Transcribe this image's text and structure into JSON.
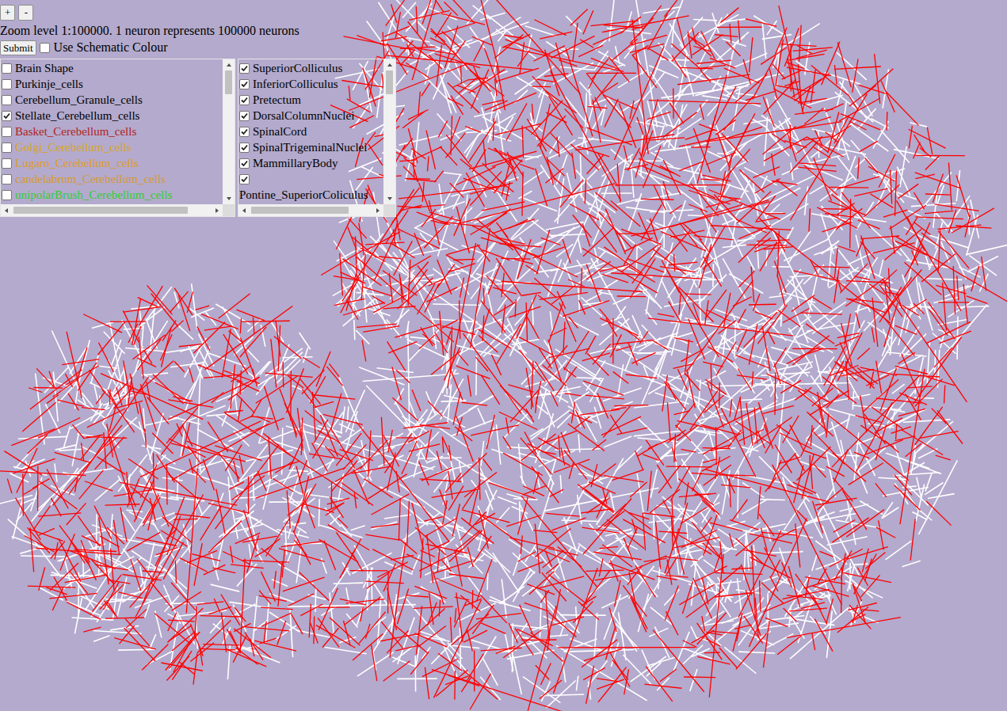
{
  "zoom": {
    "buttons": [
      "+",
      "-"
    ],
    "label": "Zoom level 1:100000. 1 neuron represents 100000 neurons"
  },
  "submit": {
    "label": "Submit"
  },
  "schematic": {
    "label": "Use Schematic Colour",
    "checked": false
  },
  "cell_list": [
    {
      "label": "Brain Shape",
      "checked": false,
      "color": "#000000"
    },
    {
      "label": "Purkinje_cells",
      "checked": false,
      "color": "#000000"
    },
    {
      "label": "Cerebellum_Granule_cells",
      "checked": false,
      "color": "#000000"
    },
    {
      "label": "Stellate_Cerebellum_cells",
      "checked": true,
      "color": "#000000"
    },
    {
      "label": "Basket_Cerebellum_cells",
      "checked": false,
      "color": "#b22222"
    },
    {
      "label": "Golgi_Cerebellum_cells",
      "checked": false,
      "color": "#daa520"
    },
    {
      "label": "Lugaro_Cerebellum_cells",
      "checked": false,
      "color": "#e09a2a"
    },
    {
      "label": "candelabrum_Cerebellum_cells",
      "checked": false,
      "color": "#d69a30"
    },
    {
      "label": "unipolarBrush_Cerebellum_cells",
      "checked": false,
      "color": "#32cd32"
    }
  ],
  "region_list": [
    {
      "label": "SuperiorColliculus",
      "checked": true,
      "kind": "inline"
    },
    {
      "label": "InferiorColliculus",
      "checked": true,
      "kind": "inline"
    },
    {
      "label": "Pretectum",
      "checked": true,
      "kind": "inline"
    },
    {
      "label": "DorsalColumnNuclei",
      "checked": true,
      "kind": "inline"
    },
    {
      "label": "SpinalCord",
      "checked": true,
      "kind": "inline"
    },
    {
      "label": "SpinalTrigeminalNuclei",
      "checked": true,
      "kind": "inline"
    },
    {
      "label": "MammillaryBody",
      "checked": true,
      "kind": "inline"
    },
    {
      "label": "Pontine_SuperiorColiculus",
      "checked": true,
      "kind": "wrapped"
    }
  ],
  "canvas": {
    "stroke_colors": [
      "#ffffff",
      "#ff0000"
    ]
  }
}
